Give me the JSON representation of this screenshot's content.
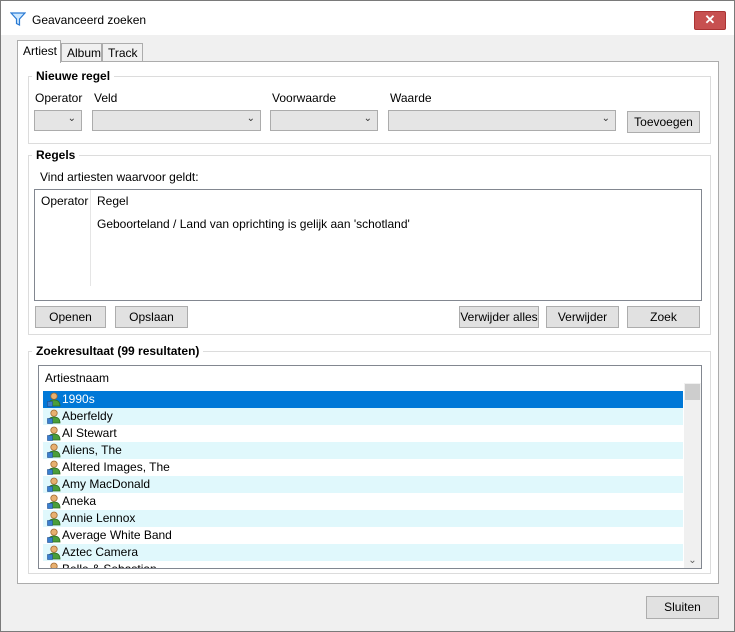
{
  "window": {
    "title": "Geavanceerd zoeken",
    "close_glyph": "✕"
  },
  "tabs": [
    {
      "label": "Artiest",
      "active": true
    },
    {
      "label": "Album",
      "active": false
    },
    {
      "label": "Track",
      "active": false
    }
  ],
  "new_rule": {
    "title": "Nieuwe regel",
    "labels": {
      "operator": "Operator",
      "field": "Veld",
      "condition": "Voorwaarde",
      "value": "Waarde"
    },
    "add_button": "Toevoegen"
  },
  "rules": {
    "title": "Regels",
    "intro": "Vind artiesten waarvoor geldt:",
    "columns": {
      "operator": "Operator",
      "rule": "Regel"
    },
    "items": [
      {
        "operator": "",
        "rule": "Geboorteland / Land van oprichting is gelijk aan 'schotland'"
      }
    ],
    "buttons": {
      "open": "Openen",
      "save": "Opslaan",
      "delete_all": "Verwijder alles",
      "delete": "Verwijder",
      "search": "Zoek"
    }
  },
  "results": {
    "title": "Zoekresultaat (99 resultaten)",
    "column": "Artiestnaam",
    "items": [
      "1990s",
      "Aberfeldy",
      "Al Stewart",
      "Aliens, The",
      "Altered Images, The",
      "Amy MacDonald",
      "Aneka",
      "Annie Lennox",
      "Average White Band",
      "Aztec Camera",
      "Belle & Sebastian"
    ],
    "selected_index": 0
  },
  "footer": {
    "close_button": "Sluiten"
  },
  "colors": {
    "selection": "#0078d7",
    "alt_row": "#e0f8fc",
    "close_red": "#c75050"
  },
  "icons": {
    "window": "filter-icon",
    "artist": "person-icon"
  }
}
